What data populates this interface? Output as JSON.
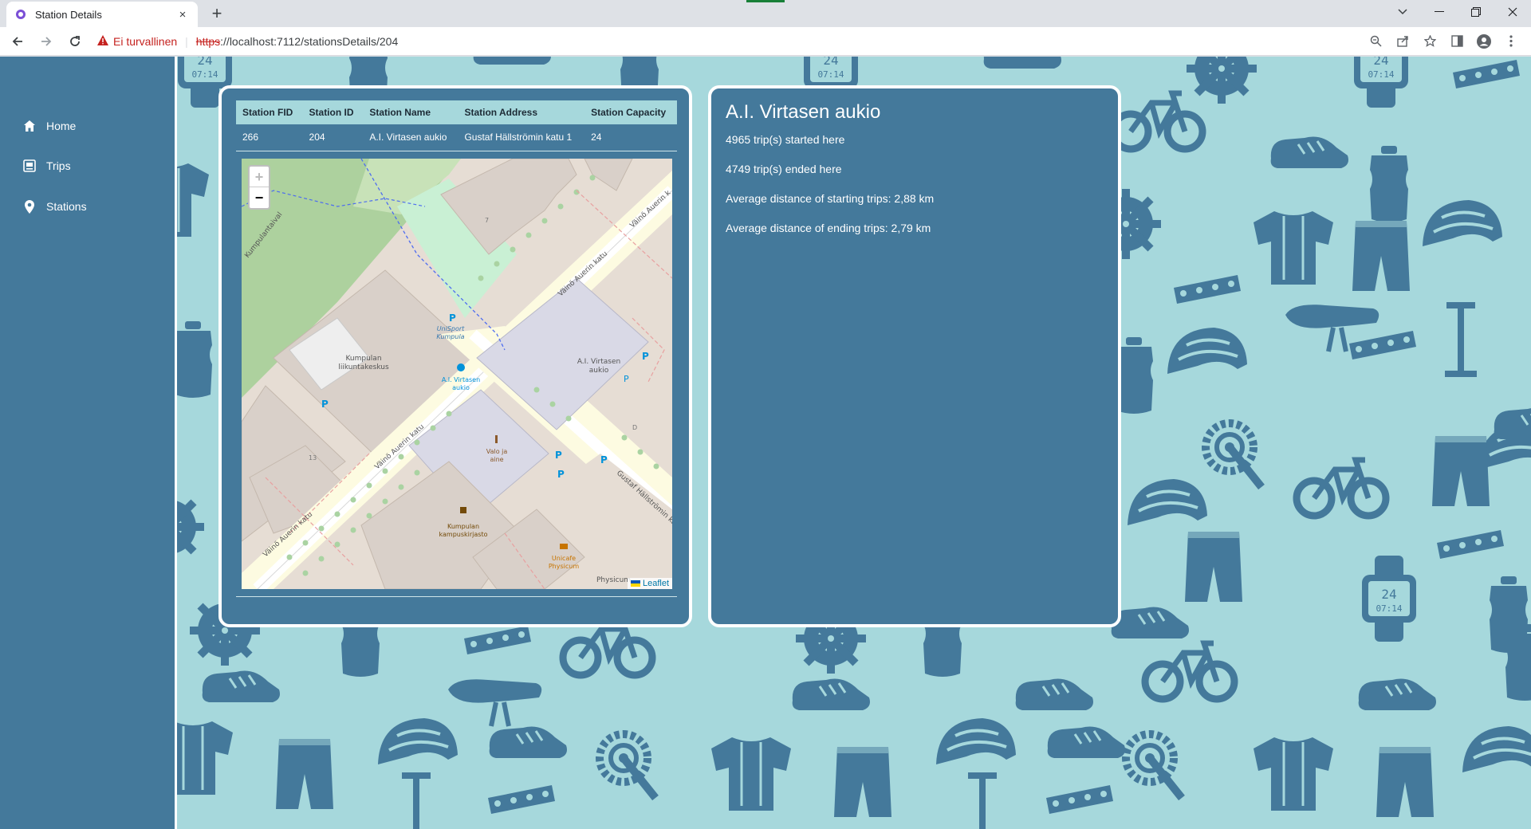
{
  "browser": {
    "tab_title": "Station Details",
    "tab_close": "×",
    "new_tab": "+",
    "security_label": "Ei turvallinen",
    "url_scheme": "https",
    "url_rest": "://localhost:7112/stationsDetails/204"
  },
  "sidebar": {
    "items": [
      {
        "label": "Home",
        "icon": "home-icon"
      },
      {
        "label": "Trips",
        "icon": "trips-icon"
      },
      {
        "label": "Stations",
        "icon": "map-pin-icon"
      }
    ]
  },
  "station_table": {
    "headers": [
      "Station FID",
      "Station ID",
      "Station Name",
      "Station Address",
      "Station Capacity"
    ],
    "row": [
      "266",
      "204",
      "A.I. Virtasen aukio",
      "Gustaf Hällströmin katu 1",
      "24"
    ]
  },
  "map": {
    "zoom_in": "+",
    "zoom_out": "−",
    "attribution": "Leaflet",
    "labels": {
      "kumpulantaival": "Kumpulantaival",
      "vaino1": "Väinö Auerin katu",
      "vaino2": "Väinö Auerin katu",
      "vaino3": "Väinö Auerin katu",
      "vaino4": "Väinö Auerin katu",
      "vaino5": "Väinö Auerin k",
      "gustaf": "Gustaf Hällströmin katu",
      "liikunta1": "Kumpulan",
      "liikunta2": "liikuntakeskus",
      "unisport1": "UniSport",
      "unisport2": "Kumpula",
      "station1": "A.I. Virtasen",
      "station2": "aukio",
      "building1": "A.I. Virtasen",
      "building2": "aukio",
      "valo1": "Valo ja",
      "valo2": "aine",
      "kirjasto1": "Kumpulan",
      "kirjasto2": "kampuskirjasto",
      "unicafe1": "Unicafe",
      "unicafe2": "Physicum",
      "physicum": "Physicum",
      "num13": "13",
      "num7": "7",
      "letterD": "D"
    }
  },
  "details": {
    "title": "A.I. Virtasen aukio",
    "started": "4965 trip(s) started here",
    "ended": "4749 trip(s) ended here",
    "avg_start": "Average distance of starting trips: 2,88 km",
    "avg_end": "Average distance of ending trips: 2,79 km"
  },
  "colors": {
    "primary": "#44799b",
    "background": "#a6d8dc",
    "card_border": "#ffffff",
    "warning": "#c5221f"
  }
}
